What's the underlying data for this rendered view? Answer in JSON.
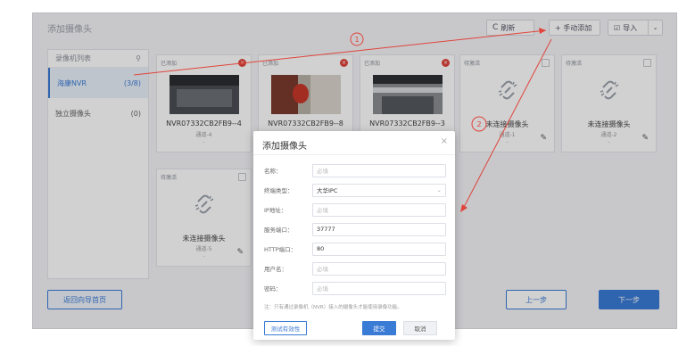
{
  "page": {
    "title": "添加摄像头",
    "toolbar": {
      "refresh": "刷新",
      "manual_add": "+ 手动添加",
      "import": "导入"
    }
  },
  "sidebar": {
    "header": "录像机列表",
    "items": [
      {
        "label": "海康NVR",
        "count": "(3/8)"
      },
      {
        "label": "独立摄像头",
        "count": "(0)"
      }
    ]
  },
  "cards": [
    {
      "status": "已添加",
      "name": "NVR07332CB2FB9--4",
      "channel": "通道-4",
      "dash": "-"
    },
    {
      "status": "已添加",
      "name": "NVR07332CB2FB9--8",
      "channel": "",
      "dash": ""
    },
    {
      "status": "已添加",
      "name": "NVR07332CB2FB9--3",
      "channel": "",
      "dash": ""
    },
    {
      "status": "待激活",
      "name": "未连接摄像头",
      "channel": "通道-1",
      "dash": "-"
    },
    {
      "status": "待激活",
      "name": "未连接摄像头",
      "channel": "通道-2",
      "dash": "-"
    },
    {
      "status": "待激活",
      "name": "未连接摄像头",
      "channel": "通道-5",
      "dash": "-"
    }
  ],
  "footer": {
    "back": "返回向导首页",
    "prev": "上一步",
    "next": "下一步"
  },
  "modal": {
    "title": "添加摄像头",
    "fields": [
      {
        "label": "名称：",
        "value": "",
        "placeholder": "必填"
      },
      {
        "label": "终端类型：",
        "value": "大华IPC",
        "placeholder": ""
      },
      {
        "label": "IP地址：",
        "value": "",
        "placeholder": "必填"
      },
      {
        "label": "服务端口：",
        "value": "37777",
        "placeholder": ""
      },
      {
        "label": "HTTP端口：",
        "value": "80",
        "placeholder": ""
      },
      {
        "label": "用户名：",
        "value": "",
        "placeholder": "必填"
      },
      {
        "label": "密码：",
        "value": "",
        "placeholder": "必填"
      }
    ],
    "note": "注：只有通过录像机（NVR）接入的摄像头才能使用录像功能。",
    "test_btn": "测试有效性",
    "submit_btn": "提交",
    "cancel_btn": "取消"
  },
  "annotations": {
    "step1": "1",
    "step2": "2"
  },
  "colors": {
    "primary": "#3a7bd5",
    "danger": "#e0443b",
    "annotation": "#e0443b"
  }
}
